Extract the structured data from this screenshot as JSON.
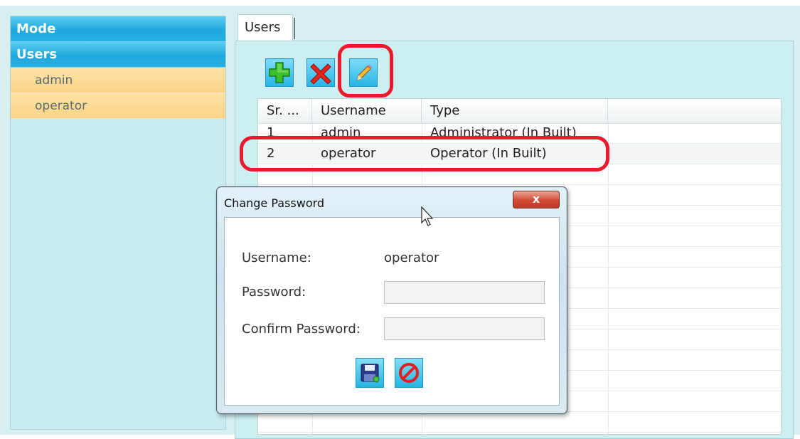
{
  "sidebar": {
    "header_mode": "Mode",
    "header_users": "Users",
    "items": [
      {
        "label": "admin"
      },
      {
        "label": "operator"
      }
    ]
  },
  "tab": {
    "label": "Users"
  },
  "toolbar": {
    "add_icon": "add-user-icon",
    "delete_icon": "delete-user-icon",
    "edit_icon": "edit-pencil-icon"
  },
  "grid": {
    "columns": [
      "Sr. ...",
      "Username",
      "Type"
    ],
    "rows": [
      {
        "sr": "1",
        "username": "admin",
        "type": "Administrator (In Built)"
      },
      {
        "sr": "2",
        "username": "operator",
        "type": "Operator (In Built)"
      }
    ]
  },
  "dialog": {
    "title": "Change Password",
    "close_label": "x",
    "username_label": "Username:",
    "username_value": "operator",
    "password_label": "Password:",
    "password_value": "",
    "confirm_label": "Confirm Password:",
    "confirm_value": "",
    "save_icon": "save-disk-icon",
    "cancel_icon": "cancel-icon"
  },
  "colors": {
    "accent": "#1fa8dd",
    "highlight": "#ea1a2d",
    "tree_child": "#fbd489"
  }
}
